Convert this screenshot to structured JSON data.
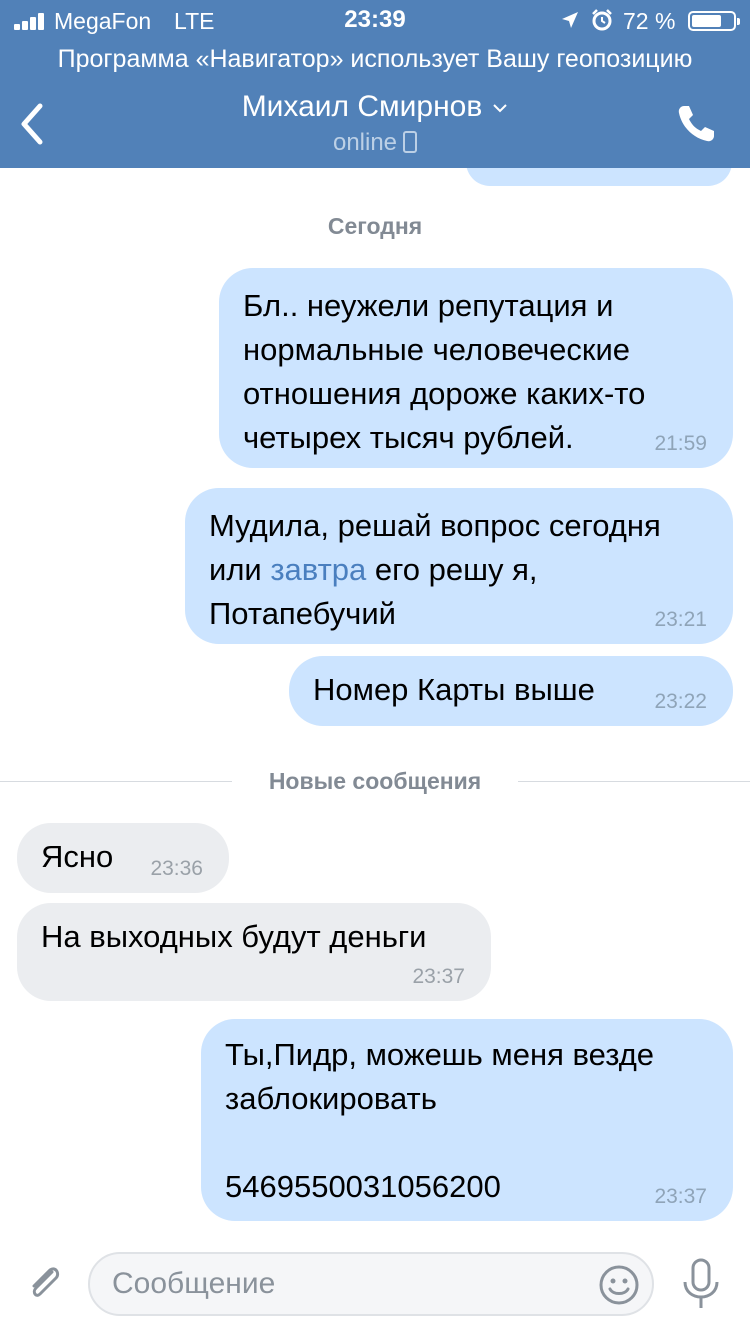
{
  "status_bar": {
    "carrier": "MegaFon",
    "network": "LTE",
    "time": "23:39",
    "battery_percent": "72 %",
    "battery_level": 0.72
  },
  "geo_banner": "Программа «Навигатор» использует Вашу геопозицию",
  "header": {
    "contact_name": "Михаил Смирнов",
    "presence": "online"
  },
  "chat": {
    "day_separator": "Сегодня",
    "new_messages_separator": "Новые сообщения",
    "messages": [
      {
        "direction": "out",
        "text": "Бл.. неужели репутация и нормальные человеческие отношения дороже каких-то четырех тысяч рублей.",
        "time": "21:59"
      },
      {
        "direction": "out",
        "text_before_link": "Мудила, решай вопрос сегодня или ",
        "link": "завтра",
        "text_after_link": " его решу я, Потапебучий",
        "time": "23:21"
      },
      {
        "direction": "out",
        "text": "Номер Карты выше",
        "time": "23:22"
      },
      {
        "direction": "in",
        "text": "Ясно",
        "time": "23:36"
      },
      {
        "direction": "in",
        "text": "На выходных будут деньги",
        "time": "23:37"
      },
      {
        "direction": "out",
        "text": "Ты,Пидр, можешь меня везде заблокировать\n\n5469550031056200",
        "time": "23:37"
      }
    ]
  },
  "composer": {
    "placeholder": "Сообщение"
  },
  "colors": {
    "header_bg": "#5181b8",
    "outgoing_bubble": "#cce4ff",
    "incoming_bubble": "#ebedf0",
    "link": "#4a7fbf"
  },
  "icons": [
    "signal-icon",
    "location-arrow-icon",
    "alarm-icon",
    "battery-icon",
    "back-chevron-icon",
    "chevron-down-icon",
    "mobile-device-icon",
    "phone-icon",
    "paperclip-icon",
    "emoji-icon",
    "microphone-icon"
  ]
}
